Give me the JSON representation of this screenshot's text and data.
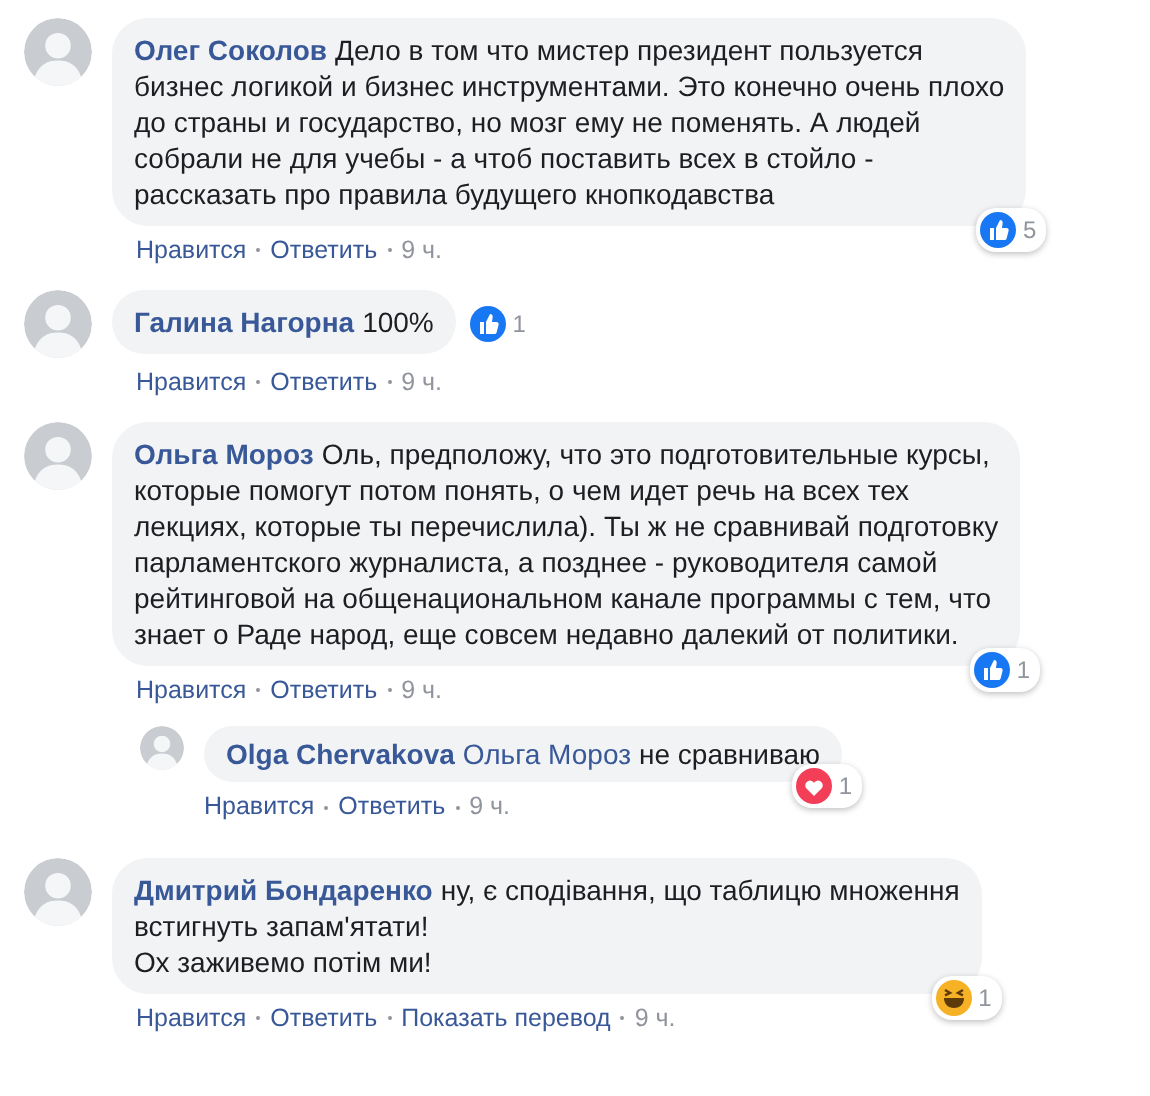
{
  "comments": [
    {
      "author": "Олег Соколов",
      "text": "Дело в том что мистер президент пользуется\nбизнес логикой и бизнес инструментами. Это конечно очень плохо\nдо страны и государство, но мозг ему не поменять. А людей\nсобрали не для учебы - а чтоб поставить всех в стойло -\nрассказать про правила будущего кнопкодавства",
      "reaction": {
        "kind": "like",
        "count": "5"
      },
      "actions": [
        "Нравится",
        "Ответить"
      ],
      "time": "9 ч."
    },
    {
      "author": "Галина Нагорна",
      "text": "100%",
      "reaction": {
        "kind": "like",
        "count": "1"
      },
      "actions": [
        "Нравится",
        "Ответить"
      ],
      "time": "9 ч."
    },
    {
      "author": "Ольга Мороз",
      "text": "Оль, предположу, что это подготовительные курсы,\nкоторые помогут потом понять, о чем идет речь на всех тех\nлекциях, которые ты перечислила). Ты ж не сравнивай подготовку\nпарламентского журналиста, а позднее - руководителя самой\nрейтинговой на общенациональном канале программы с тем, что\nзнает о Раде народ, еще совсем недавно далекий от политики.",
      "reaction": {
        "kind": "like",
        "count": "1"
      },
      "actions": [
        "Нравится",
        "Ответить"
      ],
      "time": "9 ч.",
      "replies": [
        {
          "author": "Olga Chervakova",
          "mention": "Ольга Мороз",
          "text": "не сравниваю",
          "reaction": {
            "kind": "love",
            "count": "1"
          },
          "actions": [
            "Нравится",
            "Ответить"
          ],
          "time": "9 ч."
        }
      ]
    },
    {
      "author": "Дмитрий Бондаренко",
      "text": "ну, є сподівання, що таблицю множення\nвстигнуть запам'ятати!\nОх заживемо потім ми!",
      "reaction": {
        "kind": "haha",
        "count": "1"
      },
      "actions": [
        "Нравится",
        "Ответить",
        "Показать перевод"
      ],
      "time": "9 ч."
    }
  ]
}
